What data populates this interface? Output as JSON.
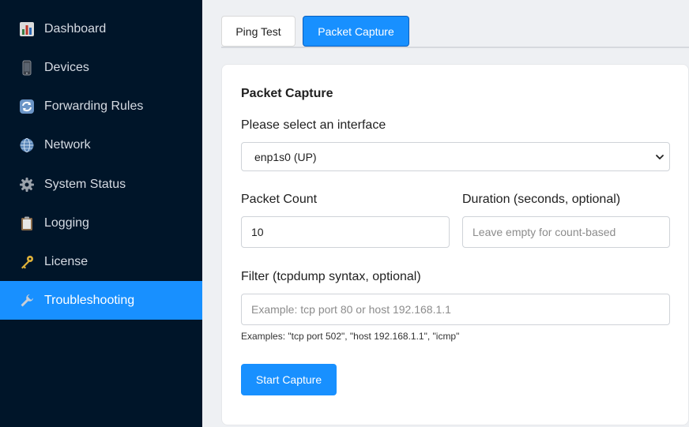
{
  "sidebar": {
    "items": [
      {
        "label": "Dashboard",
        "icon": "bar-chart-icon",
        "active": false
      },
      {
        "label": "Devices",
        "icon": "phone-icon",
        "active": false
      },
      {
        "label": "Forwarding Rules",
        "icon": "refresh-icon",
        "active": false
      },
      {
        "label": "Network",
        "icon": "globe-icon",
        "active": false
      },
      {
        "label": "System Status",
        "icon": "gear-icon",
        "active": false
      },
      {
        "label": "Logging",
        "icon": "clipboard-icon",
        "active": false
      },
      {
        "label": "License",
        "icon": "key-icon",
        "active": false
      },
      {
        "label": "Troubleshooting",
        "icon": "wrench-icon",
        "active": true
      }
    ]
  },
  "tabs": [
    {
      "label": "Ping Test",
      "active": false
    },
    {
      "label": "Packet Capture",
      "active": true
    }
  ],
  "capture": {
    "title": "Packet Capture",
    "interface_label": "Please select an interface",
    "interface_value": "enp1s0 (UP)",
    "count_label": "Packet Count",
    "count_value": "10",
    "duration_label": "Duration (seconds, optional)",
    "duration_placeholder": "Leave empty for count-based",
    "filter_label": "Filter (tcpdump syntax, optional)",
    "filter_placeholder": "Example: tcp port 80 or host 192.168.1.1",
    "filter_hint": "Examples: \"tcp port 502\", \"host 192.168.1.1\", \"icmp\"",
    "start_button": "Start Capture"
  },
  "colors": {
    "sidebar_bg": "#001529",
    "accent": "#1890ff",
    "page_bg": "#eef0f3"
  }
}
